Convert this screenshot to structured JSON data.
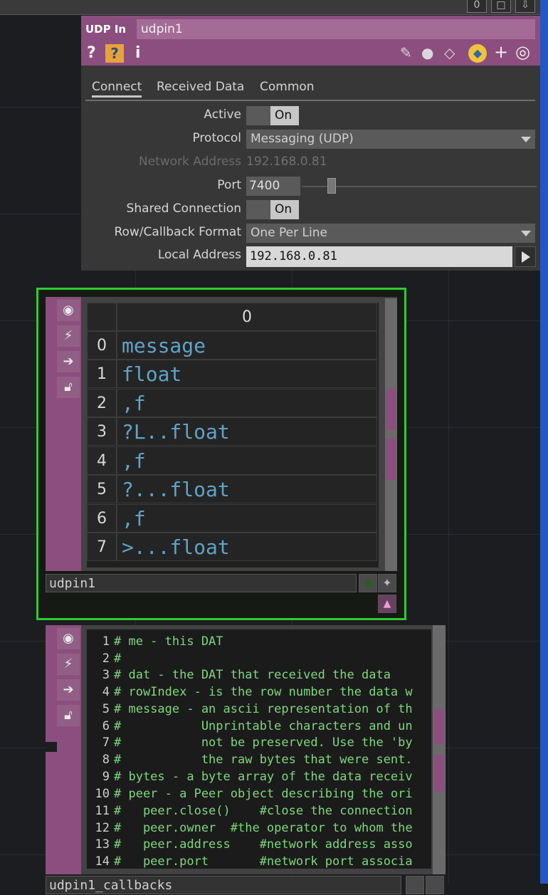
{
  "topbar": {
    "buttons": [
      "0",
      "□",
      "⇩"
    ]
  },
  "param_panel": {
    "op_type": "UDP In",
    "op_name": "udpin1",
    "tabs": [
      "Connect",
      "Received Data",
      "Common"
    ],
    "active_tab": "Connect",
    "params": {
      "active": {
        "label": "Active",
        "value": "On"
      },
      "protocol": {
        "label": "Protocol",
        "value": "Messaging (UDP)"
      },
      "network_address": {
        "label": "Network Address",
        "value": "192.168.0.81"
      },
      "port": {
        "label": "Port",
        "value": "7400"
      },
      "shared_connection": {
        "label": "Shared Connection",
        "value": "On"
      },
      "row_callback_format": {
        "label": "Row/Callback Format",
        "value": "One Per Line"
      },
      "local_address": {
        "label": "Local Address",
        "value": "192.168.0.81"
      }
    },
    "head_icons": {
      "help": "?",
      "python_help": "?",
      "info": "i"
    }
  },
  "node1": {
    "name": "udpin1",
    "column_header": "0",
    "rows": [
      {
        "index": "0",
        "value": "message"
      },
      {
        "index": "1",
        "value": "float"
      },
      {
        "index": "2",
        "value": ",f"
      },
      {
        "index": "3",
        "value": "?L..float"
      },
      {
        "index": "4",
        "value": ",f"
      },
      {
        "index": "5",
        "value": "?...float"
      },
      {
        "index": "6",
        "value": ",f"
      },
      {
        "index": "7",
        "value": ">...float"
      }
    ]
  },
  "node2": {
    "name": "udpin1_callbacks",
    "lines": [
      {
        "n": "1",
        "t": "# me - this DAT"
      },
      {
        "n": "2",
        "t": "#"
      },
      {
        "n": "3",
        "t": "# dat - the DAT that received the data"
      },
      {
        "n": "4",
        "t": "# rowIndex - is the row number the data w"
      },
      {
        "n": "5",
        "t": "# message - an ascii representation of th"
      },
      {
        "n": "6",
        "t": "#           Unprintable characters and un"
      },
      {
        "n": "7",
        "t": "#           not be preserved. Use the 'by"
      },
      {
        "n": "8",
        "t": "#           the raw bytes that were sent."
      },
      {
        "n": "9",
        "t": "# bytes - a byte array of the data receiv"
      },
      {
        "n": "10",
        "t": "# peer - a Peer object describing the ori"
      },
      {
        "n": "11",
        "t": "#   peer.close()    #close the connection"
      },
      {
        "n": "12",
        "t": "#   peer.owner  #the operator to whom the"
      },
      {
        "n": "13",
        "t": "#   peer.address    #network address asso"
      },
      {
        "n": "14",
        "t": "#   peer.port       #network port associa"
      }
    ]
  },
  "colors": {
    "accent": "#8c4e7e",
    "selection": "#2ecc2e",
    "table_text": "#5fa3c8",
    "code_text": "#7dd87d"
  }
}
